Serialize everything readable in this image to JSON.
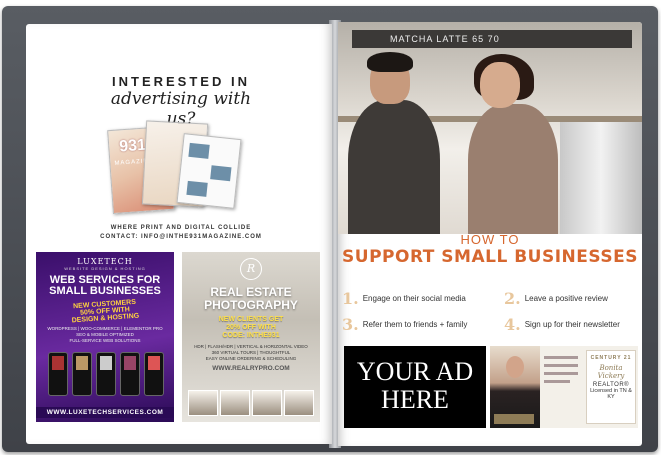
{
  "left_page": {
    "advertise": {
      "line1": "INTERESTED IN",
      "line2": "advertising with us?"
    },
    "magazine_cover": {
      "title": "931",
      "subtitle": "MAGAZINE"
    },
    "tagline": "WHERE PRINT AND DIGITAL COLLIDE",
    "contact": "CONTACT: INFO@INTHE931MAGAZINE.COM",
    "luxetech_ad": {
      "brand": "LUXETECH",
      "small": "WEBSITE DESIGN & HOSTING",
      "title_line1": "WEB SERVICES FOR",
      "title_line2": "SMALL BUSINESSES",
      "promo_line1": "NEW CUSTOMERS",
      "promo_line2": "50% OFF WITH",
      "promo_line3": "DESIGN & HOSTING",
      "services": "WORDPRESS | WOO-COMMERCE | ELEMENTOR PRO",
      "services2": "SEO & MOBILE OPTIMIZED",
      "services3": "FULL-SERVICE WEB SOLUTIONS",
      "url": "WWW.LUXETECHSERVICES.COM"
    },
    "realestate_ad": {
      "title_line1": "REAL ESTATE",
      "title_line2": "PHOTOGRAPHY",
      "promo_line1": "NEW CLIENTS GET",
      "promo_line2": "20% OFF WITH",
      "promo_line3": "CODE: INTHE931",
      "details": "HDR | FLASH/HDR | VERTICAL & HORIZONTAL VIDEO",
      "details2": "360 VIRTUAL TOURS | THOUGHTFUL",
      "details3": "EASY ONLINE ORDERING & SCHEDULING",
      "url": "WWW.REALRYPRO.COM"
    }
  },
  "right_page": {
    "menu_board": "MATCHA LATTE   65   70",
    "headline_line1": "HOW TO",
    "headline_line2": "SUPPORT SMALL BUSINESSES",
    "tips": [
      {
        "num": "1.",
        "text": "Engage on their social media"
      },
      {
        "num": "2.",
        "text": "Leave a positive review"
      },
      {
        "num": "3.",
        "text": "Refer them to friends + family"
      },
      {
        "num": "4.",
        "text": "Sign up for their newsletter"
      }
    ],
    "your_ad_line1": "YOUR AD",
    "your_ad_line2": "HERE",
    "agent": {
      "brand": "CENTURY 21",
      "name": "Bonita Vickery",
      "role": "REALTOR®",
      "license": "Licensed in TN & KY"
    }
  },
  "colors": {
    "headline": "#d6672f",
    "tip_numbers": "#e8c79d",
    "luxetech_bg": "#3a0f6a",
    "promo_yellow": "#ffd23f",
    "frame": "#4a4d53"
  }
}
